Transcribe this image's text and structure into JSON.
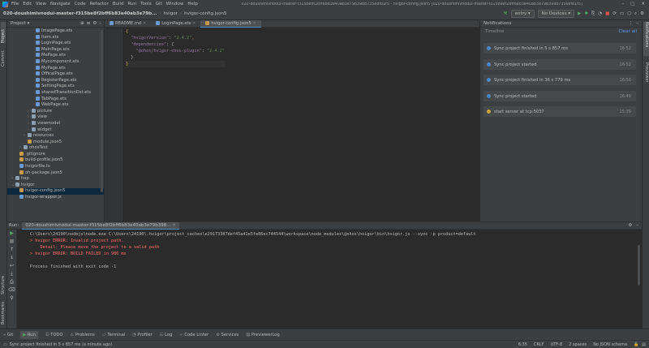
{
  "titlebar": {
    "menu": [
      "File",
      "Edit",
      "View",
      "Navigate",
      "Code",
      "Refactor",
      "Build",
      "Run",
      "Tools",
      "Git",
      "Window",
      "Help"
    ],
    "title": "020-doushimivnodui-master-f315be8f2bff6b83e40ab3e79b398b735e8fb1f5 - hvigor-config.json5 [020-doushimivnodui-master-f315be8f2bff6b83e40ab3e79b398b735e8fb1f5]"
  },
  "navbar": {
    "breadcrumb": [
      "020-doushimivnodui-master-f315be8f2bff6b83e40ab3e79b...",
      "hvigor",
      "hvigor-config.json5"
    ],
    "config": "entry",
    "devices": "No Devices"
  },
  "left_strip": {
    "project": "Project",
    "commit": "Commit",
    "structure": "Structure",
    "bookmarks": "Bookmarks"
  },
  "project_panel": {
    "header": "Project",
    "items": [
      {
        "label": "ImagePage.ets",
        "indent": 6,
        "type": "ets"
      },
      {
        "label": "Item.ets",
        "indent": 6,
        "type": "ets"
      },
      {
        "label": "LoginPage.ets",
        "indent": 6,
        "type": "ets"
      },
      {
        "label": "MainPage.ets",
        "indent": 6,
        "type": "ets"
      },
      {
        "label": "MePage.ets",
        "indent": 6,
        "type": "ets"
      },
      {
        "label": "Mycomponent.ets",
        "indent": 6,
        "type": "ets"
      },
      {
        "label": "MyPage.ets",
        "indent": 6,
        "type": "ets"
      },
      {
        "label": "OfficalPage.ets",
        "indent": 6,
        "type": "ets"
      },
      {
        "label": "RegisterPage.ets",
        "indent": 6,
        "type": "ets"
      },
      {
        "label": "SettingPage.ets",
        "indent": 6,
        "type": "ets"
      },
      {
        "label": "sharedTransitionDst.ets",
        "indent": 6,
        "type": "ets"
      },
      {
        "label": "TabPage.ets",
        "indent": 6,
        "type": "ets"
      },
      {
        "label": "WebPage.ets",
        "indent": 6,
        "type": "ets"
      },
      {
        "label": "picture",
        "indent": 5,
        "type": "folder",
        "arrow": "›"
      },
      {
        "label": "view",
        "indent": 5,
        "type": "folder",
        "arrow": "›"
      },
      {
        "label": "viewmodel",
        "indent": 5,
        "type": "folder",
        "arrow": "›"
      },
      {
        "label": "widget",
        "indent": 5,
        "type": "folder",
        "arrow": "›"
      },
      {
        "label": "resources",
        "indent": 4,
        "type": "folder",
        "arrow": "›"
      },
      {
        "label": "module.json5",
        "indent": 4,
        "type": "json"
      },
      {
        "label": "ohosTest",
        "indent": 3,
        "type": "folder",
        "arrow": "›"
      },
      {
        "label": ".gitignore",
        "indent": 2,
        "type": "json"
      },
      {
        "label": "build-profile.json5",
        "indent": 2,
        "type": "json"
      },
      {
        "label": "hvigorfile.ts",
        "indent": 2,
        "type": "ets"
      },
      {
        "label": "oh-package.json5",
        "indent": 2,
        "type": "json"
      },
      {
        "label": "hap",
        "indent": 1,
        "type": "folder",
        "arrow": "›"
      },
      {
        "label": "hvigor",
        "indent": 1,
        "type": "folder",
        "arrow": "⌄"
      },
      {
        "label": "hvigor-config.json5",
        "indent": 2,
        "type": "json"
      },
      {
        "label": "hvigor-wrapper.js",
        "indent": 2,
        "type": "ets"
      }
    ]
  },
  "editor": {
    "tabs": [
      {
        "label": "README.md",
        "active": false
      },
      {
        "label": "LoginPage.ets",
        "active": false
      },
      {
        "label": "hvigor-config.json5",
        "active": true
      }
    ],
    "code": [
      [
        {
          "t": "{",
          "c": "b"
        }
      ],
      [
        {
          "t": "  ",
          "c": ""
        },
        {
          "t": "\"hvigorVersion\"",
          "c": "k"
        },
        {
          "t": ": ",
          "c": ""
        },
        {
          "t": "\"2.4.2\"",
          "c": "s"
        },
        {
          "t": ",",
          "c": "p"
        }
      ],
      [
        {
          "t": "  ",
          "c": ""
        },
        {
          "t": "\"dependencies\"",
          "c": "k"
        },
        {
          "t": ": {",
          "c": ""
        }
      ],
      [
        {
          "t": "    ",
          "c": ""
        },
        {
          "t": "\"@ohos/hvigor-ohos-plugin\"",
          "c": "k"
        },
        {
          "t": ": ",
          "c": ""
        },
        {
          "t": "\"2.4.2\"",
          "c": "s"
        }
      ],
      [
        {
          "t": "  }",
          "c": ""
        }
      ],
      [
        {
          "t": "}",
          "c": "b"
        }
      ]
    ]
  },
  "notifications": {
    "header": "Notifications",
    "timeline": "Timeline",
    "clear_all": "Clear all",
    "items": [
      {
        "text": "Sync project finished in 5 s 857 ms",
        "time": "16:52",
        "status": "ok"
      },
      {
        "text": "Sync project started",
        "time": "16:52",
        "status": "ok"
      },
      {
        "text": "Sync project finished in 36 s 779 ms",
        "time": "16:50",
        "status": "ok"
      },
      {
        "text": "Sync project started",
        "time": "16:49",
        "status": "ok"
      },
      {
        "text": "start server at tcp:5037",
        "time": "15:39",
        "status": "warn"
      }
    ]
  },
  "right_strip": {
    "notifications": "Notifications",
    "previewer": "Previewer"
  },
  "run_panel": {
    "header_label": "Run:",
    "header_tab": "020-doushimivnodui-master-f315be8f2bff6b83e40ab3e79b398...",
    "lines": [
      {
        "text": "C:\\Users\\24190\\nodejs\\node.exe C:\\Users\\24190\\.hvigor\\project_caches\\e29173387def45a41e5fe86ec744544\\workspace\\node_modules\\@ohos\\hvigor\\bin\\hvigor.js --sync -p product=default",
        "cls": ""
      },
      {
        "text": "> hvigor ERROR: Invalid project path.",
        "cls": "err"
      },
      {
        "text": "    Detail: Please move the project to a valid path",
        "cls": "err"
      },
      {
        "text": "> hvigor ERROR: BUILD FAILED in 986 ms",
        "cls": "err"
      },
      {
        "text": "",
        "cls": ""
      },
      {
        "text": "Process finished with exit code -1",
        "cls": ""
      }
    ]
  },
  "bottom_tabs": [
    "Git",
    "Run",
    "TODO",
    "Problems",
    "Terminal",
    "Profiler",
    "Log",
    "Code Linter",
    "Services",
    "PreviewerLog"
  ],
  "status": {
    "message": "Sync project finished in 5 s 857 ms (a minute ago)",
    "position": "6:35",
    "line_sep": "CRLF",
    "encoding": "UTF-8",
    "indent": "2 spaces",
    "schema": "No JSON schema"
  }
}
